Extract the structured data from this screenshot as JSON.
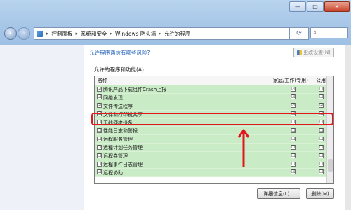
{
  "window": {
    "caption_buttons": [
      "—",
      "□",
      "✕"
    ]
  },
  "address_bar": {
    "crumbs": [
      "控制面板",
      "系统和安全",
      "Windows 防火墙",
      "允许的程序"
    ],
    "search_placeholder": "⌕"
  },
  "links": {
    "risk": "允许程序通信有哪些风险?"
  },
  "change_settings": "更改设置(N)",
  "group_label": "允许的程序和功能(A):",
  "columns": {
    "name": "名称",
    "home": "家庭/工作(专用)",
    "public": "公用"
  },
  "programs": [
    {
      "name": "腾讯产品下载组件Crash上报",
      "enabled": "☑",
      "home": "☑",
      "public": "☐"
    },
    {
      "name": "网络发现",
      "enabled": "☑",
      "home": "☑",
      "public": "☐"
    },
    {
      "name": "文件传送程序",
      "enabled": "☑",
      "home": "☑",
      "public": "☑"
    },
    {
      "name": "文件和打印机共享",
      "enabled": "☑",
      "home": "☑",
      "public": "☑"
    },
    {
      "name": "无线便携设备",
      "enabled": "☐",
      "home": "☐",
      "public": "☐"
    },
    {
      "name": "性能日志和警报",
      "enabled": "☐",
      "home": "☐",
      "public": "☐"
    },
    {
      "name": "远程服务管理",
      "enabled": "☐",
      "home": "☐",
      "public": "☐"
    },
    {
      "name": "远程计划任务管理",
      "enabled": "☐",
      "home": "☐",
      "public": "☐"
    },
    {
      "name": "远程卷管理",
      "enabled": "☐",
      "home": "☐",
      "public": "☐"
    },
    {
      "name": "远程事件日志管理",
      "enabled": "☐",
      "home": "☐",
      "public": "☐"
    },
    {
      "name": "远程协助",
      "enabled": "☑",
      "home": "☑",
      "public": "☐"
    }
  ],
  "buttons": {
    "details": "详细信息(L)...",
    "remove": "删除(M)"
  },
  "colors": {
    "row_allowed": "#c9ebc6",
    "annotation": "#e0171b",
    "link": "#1f5fb8"
  }
}
